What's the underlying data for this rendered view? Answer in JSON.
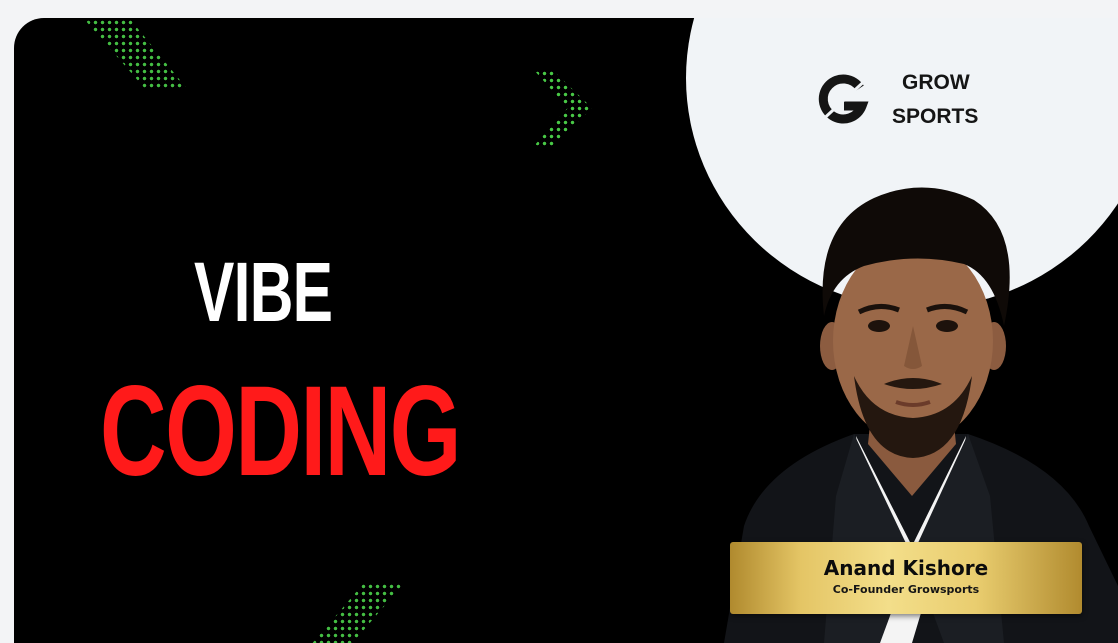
{
  "poster": {
    "title_line1": "VIBE",
    "title_line2": "CODING",
    "brand": {
      "line1": "GROW",
      "line2": "SPORTS",
      "logo_icon": "g-monogram-logo"
    },
    "speaker": {
      "name": "Anand Kishore",
      "role": "Co-Founder Growsports"
    },
    "colors": {
      "background": "#000000",
      "title_primary": "#ffffff",
      "title_accent": "#ff1a1a",
      "accent_dots": "#4cd24a",
      "nameplate_gold": "#e4c565",
      "circle": "#f1f4f7"
    }
  }
}
